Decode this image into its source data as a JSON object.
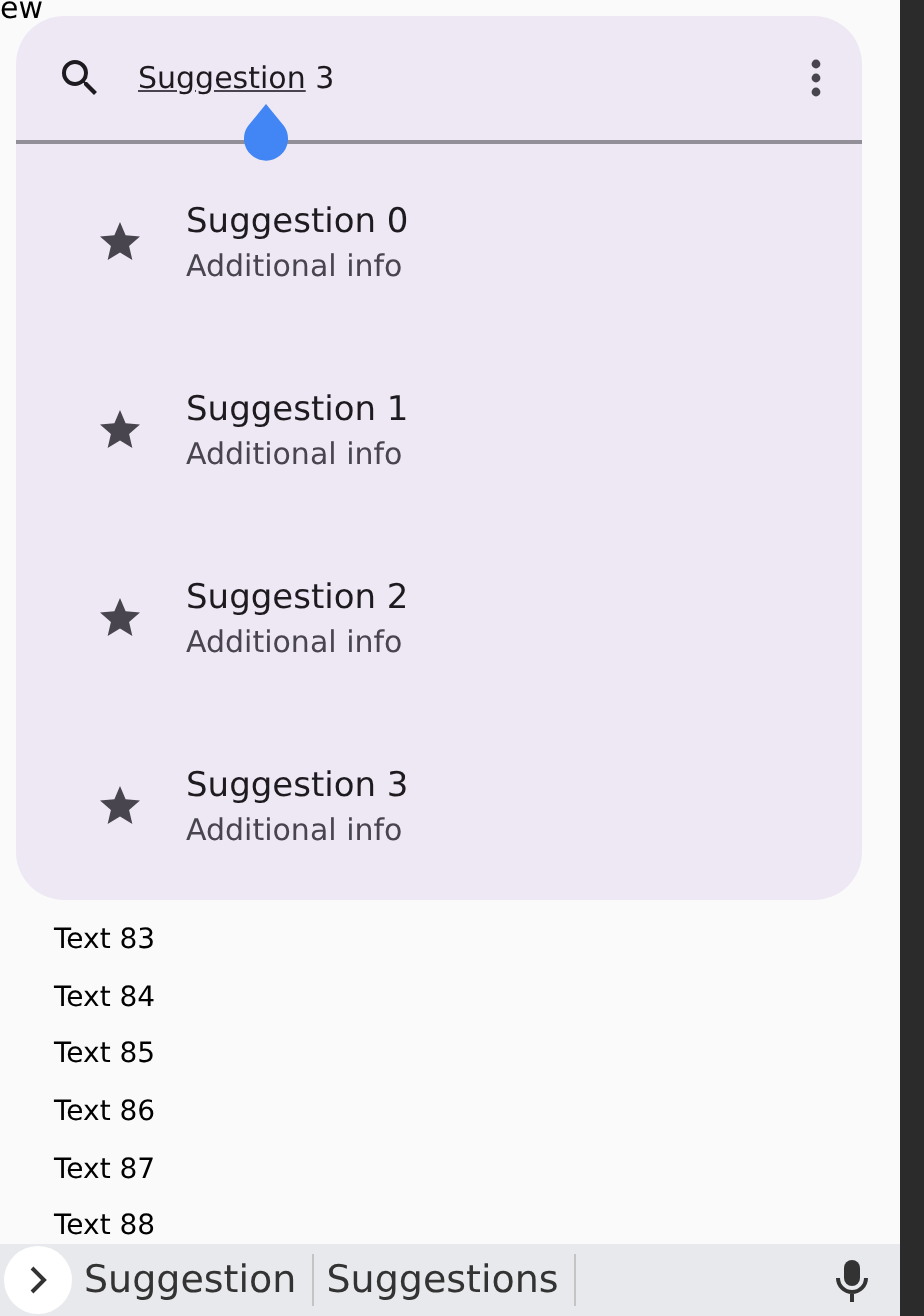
{
  "behind_text": "ew",
  "search": {
    "value_underlined": "Suggestion",
    "value_rest": " 3"
  },
  "suggestions": [
    {
      "title": "Suggestion 0",
      "subtitle": "Additional info"
    },
    {
      "title": "Suggestion 1",
      "subtitle": "Additional info"
    },
    {
      "title": "Suggestion 2",
      "subtitle": "Additional info"
    },
    {
      "title": "Suggestion 3",
      "subtitle": "Additional info"
    }
  ],
  "list": [
    "Text 83",
    "Text 84",
    "Text 85",
    "Text 86",
    "Text 87",
    "Text 88"
  ],
  "keyboard_suggestions": [
    "Suggestion",
    "Suggestions"
  ]
}
